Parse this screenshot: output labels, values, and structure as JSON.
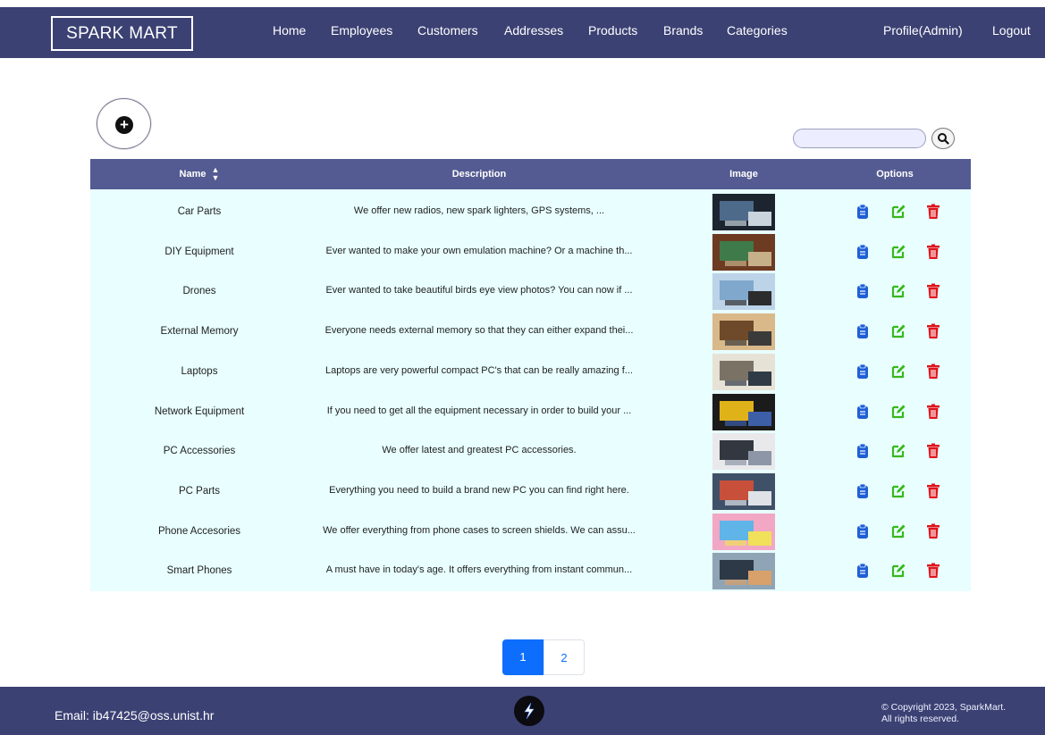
{
  "header": {
    "brand": "SPARK MART",
    "nav": [
      "Home",
      "Employees",
      "Customers",
      "Addresses",
      "Products",
      "Brands",
      "Categories"
    ],
    "profile": "Profile(Admin)",
    "logout": "Logout"
  },
  "toolbar": {
    "add_icon": "plus-circle-icon",
    "search_placeholder": "",
    "search_icon": "magnifier-icon"
  },
  "table": {
    "columns": {
      "name": "Name",
      "description": "Description",
      "image": "Image",
      "options": "Options"
    },
    "rows": [
      {
        "name": "Car Parts",
        "description": "We offer new radios, new spark lighters, GPS systems, ...",
        "image": "car-dashboard-photo"
      },
      {
        "name": "DIY Equipment",
        "description": "Ever wanted to make your own emulation machine? Or a machine th...",
        "image": "circuit-board-photo"
      },
      {
        "name": "Drones",
        "description": "Ever wanted to take beautiful birds eye view photos? You can now if ...",
        "image": "drone-photo"
      },
      {
        "name": "External Memory",
        "description": "Everyone needs external memory so that they can either expand thei...",
        "image": "external-drive-photo"
      },
      {
        "name": "Laptops",
        "description": "Laptops are very powerful compact PC's that can be really amazing f...",
        "image": "laptop-photo"
      },
      {
        "name": "Network Equipment",
        "description": "If you need to get all the equipment necessary in order to build your ...",
        "image": "network-cables-photo"
      },
      {
        "name": "PC Accessories",
        "description": "We offer latest and greatest PC accessories.",
        "image": "monitors-desk-photo"
      },
      {
        "name": "PC Parts",
        "description": "Everything you need to build a brand new PC you can find right here.",
        "image": "pc-internals-photo"
      },
      {
        "name": "Phone Accesories",
        "description": "We offer everything from phone cases to screen shields. We can assu...",
        "image": "phone-cases-photo"
      },
      {
        "name": "Smart Phones",
        "description": "A must have in today's age. It offers everything from instant commun...",
        "image": "smartphone-photo"
      }
    ],
    "options_icons": [
      "clipboard-details-icon",
      "edit-icon",
      "trash-icon"
    ]
  },
  "pagination": {
    "pages": [
      "1",
      "2"
    ],
    "active": "1"
  },
  "footer": {
    "email": "Email: ib47425@oss.unist.hr",
    "copyright_line1": "© Copyright 2023, SparkMart.",
    "copyright_line2": "All rights reserved.",
    "logo_icon": "lightning-logo-icon"
  },
  "colors": {
    "nav_bg": "#3b4173",
    "table_header_bg": "#545b92",
    "table_body_bg": "#e8feff",
    "details_icon": "#1f5fd6",
    "edit_icon": "#38b81a",
    "delete_icon": "#e0141b",
    "active_page": "#0d6efd"
  }
}
